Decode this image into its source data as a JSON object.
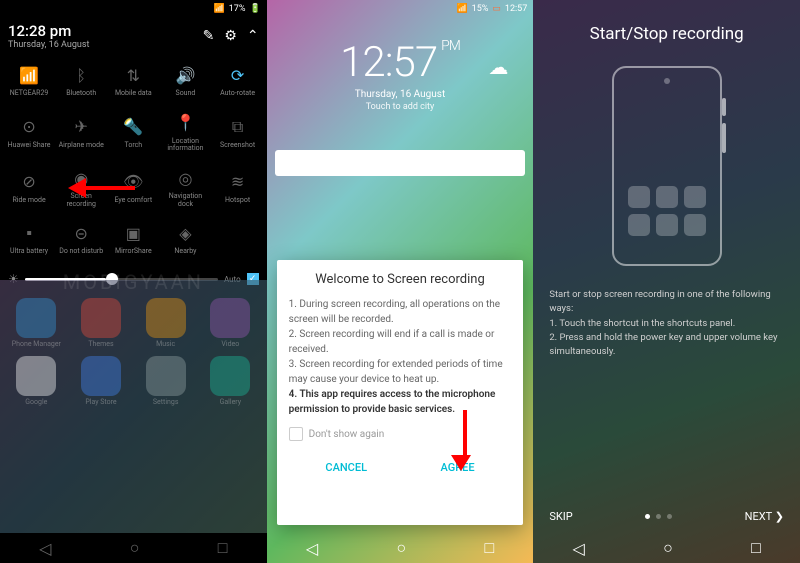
{
  "panel1": {
    "status": {
      "battery": "17%",
      "battery_icon": true
    },
    "time": "12:28 pm",
    "date": "Thursday, 16 August",
    "header_icons": [
      "edit",
      "settings",
      "collapse"
    ],
    "tiles": [
      {
        "label": "NETGEAR29",
        "icon": "wifi",
        "active": true
      },
      {
        "label": "Bluetooth",
        "icon": "bluetooth",
        "active": false
      },
      {
        "label": "Mobile data",
        "icon": "data",
        "active": false
      },
      {
        "label": "Sound",
        "icon": "sound",
        "active": true
      },
      {
        "label": "Auto-rotate",
        "icon": "rotate",
        "active": true
      },
      {
        "label": "Huawei Share",
        "icon": "share",
        "active": false
      },
      {
        "label": "Airplane mode",
        "icon": "airplane",
        "active": false
      },
      {
        "label": "Torch",
        "icon": "torch",
        "active": false
      },
      {
        "label": "Location information",
        "icon": "location",
        "active": false
      },
      {
        "label": "Screenshot",
        "icon": "screenshot",
        "active": false
      },
      {
        "label": "Ride mode",
        "icon": "ride",
        "active": false
      },
      {
        "label": "Screen recording",
        "icon": "record",
        "active": false
      },
      {
        "label": "Eye comfort",
        "icon": "eye",
        "active": false
      },
      {
        "label": "Navigation dock",
        "icon": "navdock",
        "active": false
      },
      {
        "label": "Hotspot",
        "icon": "hotspot",
        "active": false
      },
      {
        "label": "Ultra battery",
        "icon": "battery",
        "active": false
      },
      {
        "label": "Do not disturb",
        "icon": "dnd",
        "active": false
      },
      {
        "label": "MirrorShare",
        "icon": "mirror",
        "active": false
      },
      {
        "label": "Nearby",
        "icon": "nearby",
        "active": false
      }
    ],
    "brightness_auto": "Auto",
    "apps": [
      "Phone Manager",
      "Themes",
      "Music",
      "Video",
      "Google",
      "Play Store",
      "Settings",
      "Gallery"
    ]
  },
  "panel2": {
    "status": {
      "battery": "15%",
      "time": "12:57"
    },
    "clock": {
      "time": "12:57",
      "pm": "PM",
      "date": "Thursday, 16 August",
      "city": "Touch to add city"
    },
    "dialog": {
      "title": "Welcome to Screen recording",
      "l1": "1. During screen recording, all operations on the screen will be recorded.",
      "l2": "2. Screen recording will end if a call is made or received.",
      "l3": "3. Screen recording for extended periods of time may cause your device to heat up.",
      "l4": "4. This app requires access to the microphone permission to provide basic services.",
      "dont_show": "Don't show again",
      "cancel": "CANCEL",
      "agree": "AGREE"
    }
  },
  "panel3": {
    "title": "Start/Stop recording",
    "intro": "Start or stop screen recording in one of the following ways:",
    "step1": "1. Touch the shortcut in the shortcuts panel.",
    "step2": "2. Press and hold the power key and upper volume key simultaneously.",
    "skip": "SKIP",
    "next": "NEXT ❯"
  }
}
